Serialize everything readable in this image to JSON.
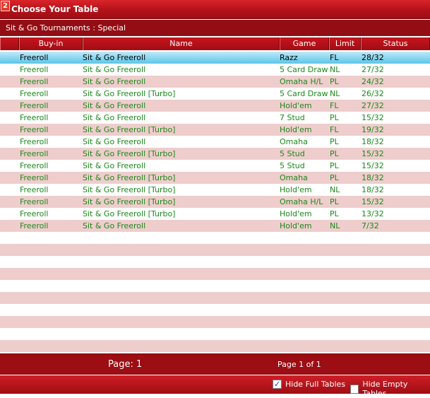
{
  "window": {
    "title": "Choose Your Table",
    "icon_glyph": "2"
  },
  "subheader": "Sit & Go Tournaments : Special",
  "columns": {
    "buyin": "Buy-in",
    "name": "Name",
    "game": "Game",
    "limit": "Limit",
    "status": "Status"
  },
  "rows": [
    {
      "buyin": "Freeroll",
      "name": "Sit & Go Freeroll",
      "game": "Razz",
      "limit": "FL",
      "status": "28/32"
    },
    {
      "buyin": "Freeroll",
      "name": "Sit & Go Freeroll",
      "game": "5 Card Draw",
      "limit": "NL",
      "status": "27/32"
    },
    {
      "buyin": "Freeroll",
      "name": "Sit & Go Freeroll",
      "game": "Omaha H/L",
      "limit": "PL",
      "status": "24/32"
    },
    {
      "buyin": "Freeroll",
      "name": "Sit & Go Freeroll [Turbo]",
      "game": "5 Card Draw",
      "limit": "NL",
      "status": "26/32"
    },
    {
      "buyin": "Freeroll",
      "name": "Sit & Go Freeroll",
      "game": "Hold'em",
      "limit": "FL",
      "status": "27/32"
    },
    {
      "buyin": "Freeroll",
      "name": "Sit & Go Freeroll",
      "game": "7 Stud",
      "limit": "PL",
      "status": "15/32"
    },
    {
      "buyin": "Freeroll",
      "name": "Sit & Go Freeroll [Turbo]",
      "game": "Hold'em",
      "limit": "FL",
      "status": "19/32"
    },
    {
      "buyin": "Freeroll",
      "name": "Sit & Go Freeroll",
      "game": "Omaha",
      "limit": "PL",
      "status": "18/32"
    },
    {
      "buyin": "Freeroll",
      "name": "Sit & Go Freeroll [Turbo]",
      "game": "5 Stud",
      "limit": "PL",
      "status": "15/32"
    },
    {
      "buyin": "Freeroll",
      "name": "Sit & Go Freeroll",
      "game": "5 Stud",
      "limit": "PL",
      "status": "15/32"
    },
    {
      "buyin": "Freeroll",
      "name": "Sit & Go Freeroll [Turbo]",
      "game": "Omaha",
      "limit": "PL",
      "status": "18/32"
    },
    {
      "buyin": "Freeroll",
      "name": "Sit & Go Freeroll [Turbo]",
      "game": "Hold'em",
      "limit": "NL",
      "status": "18/32"
    },
    {
      "buyin": "Freeroll",
      "name": "Sit & Go Freeroll [Turbo]",
      "game": "Omaha H/L",
      "limit": "PL",
      "status": "15/32"
    },
    {
      "buyin": "Freeroll",
      "name": "Sit & Go Freeroll [Turbo]",
      "game": "Hold'em",
      "limit": "PL",
      "status": "13/32"
    },
    {
      "buyin": "Freeroll",
      "name": "Sit & Go Freeroll",
      "game": "Hold'em",
      "limit": "NL",
      "status": "7/32"
    }
  ],
  "pagination": {
    "page_label": "Page: 1",
    "page_of": "Page 1 of 1"
  },
  "options": {
    "hide_full": {
      "label": "Hide Full Tables",
      "checked": true
    },
    "hide_empty": {
      "label": "Hide Empty Tables",
      "checked": false
    }
  },
  "colors": {
    "accent": "#b3121a",
    "row_stripe": "#efcdcd",
    "text_green": "#1a8a1a",
    "selected": "#5cc6ea"
  }
}
